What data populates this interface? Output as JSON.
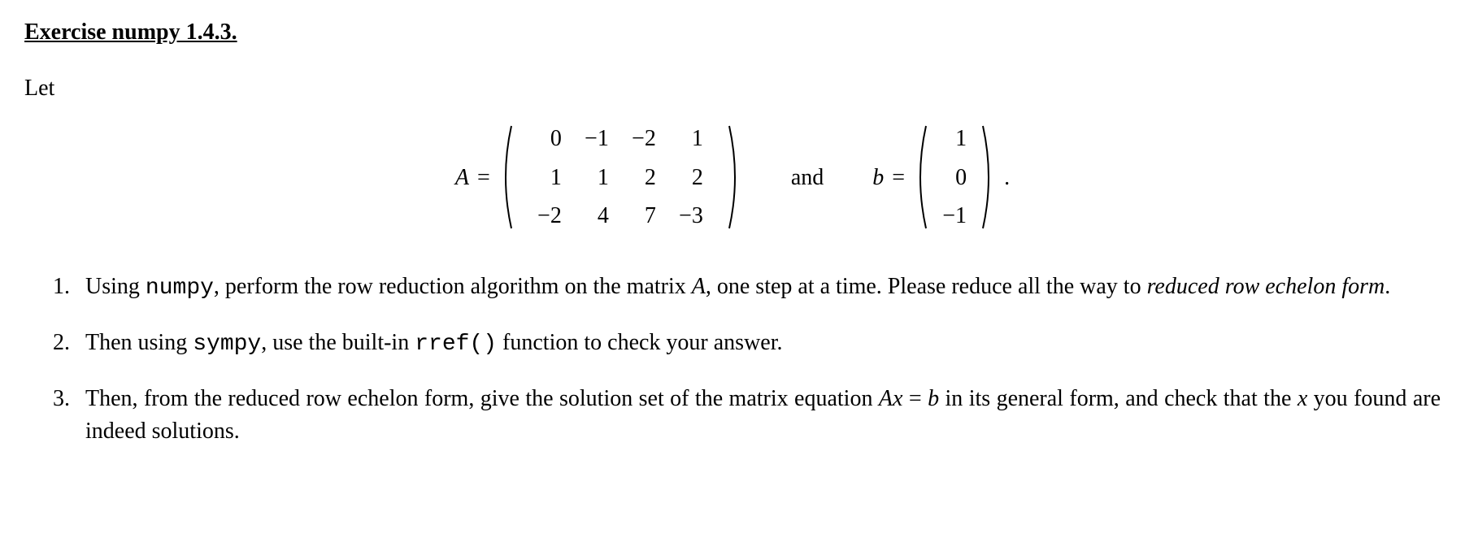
{
  "title": "Exercise numpy 1.4.3.",
  "let": "Let",
  "eqA": {
    "lhs": "A",
    "eq": "="
  },
  "matrixA": {
    "r0c0": "0",
    "r0c1": "−1",
    "r0c2": "−2",
    "r0c3": "1",
    "r1c0": "1",
    "r1c1": "1",
    "r1c2": "2",
    "r1c3": "2",
    "r2c0": "−2",
    "r2c1": "4",
    "r2c2": "7",
    "r2c3": "−3"
  },
  "and": "and",
  "eqB": {
    "lhs": "b",
    "eq": "="
  },
  "vectorB": {
    "r0": "1",
    "r1": "0",
    "r2": "−1"
  },
  "period": ".",
  "items": {
    "i1": {
      "num": "1.",
      "p1": "Using ",
      "code1": "numpy",
      "p2": ", perform the row reduction algorithm on the matrix ",
      "A": "A",
      "p3": ", one step at a time. Please reduce all the way to ",
      "em": "reduced row echelon form",
      "p4": "."
    },
    "i2": {
      "num": "2.",
      "p1": "Then using ",
      "code1": "sympy",
      "p2": ", use the built-in ",
      "code2": "rref()",
      "p3": " function to check your answer."
    },
    "i3": {
      "num": "3.",
      "p1": "Then, from the reduced row echelon form, give the solution set of the matrix equation ",
      "A": "A",
      "x1": "x",
      "eq": " = ",
      "b": "b",
      "p2": " in its general form, and check that the ",
      "x2": "x",
      "p3": " you found are indeed solutions."
    }
  }
}
